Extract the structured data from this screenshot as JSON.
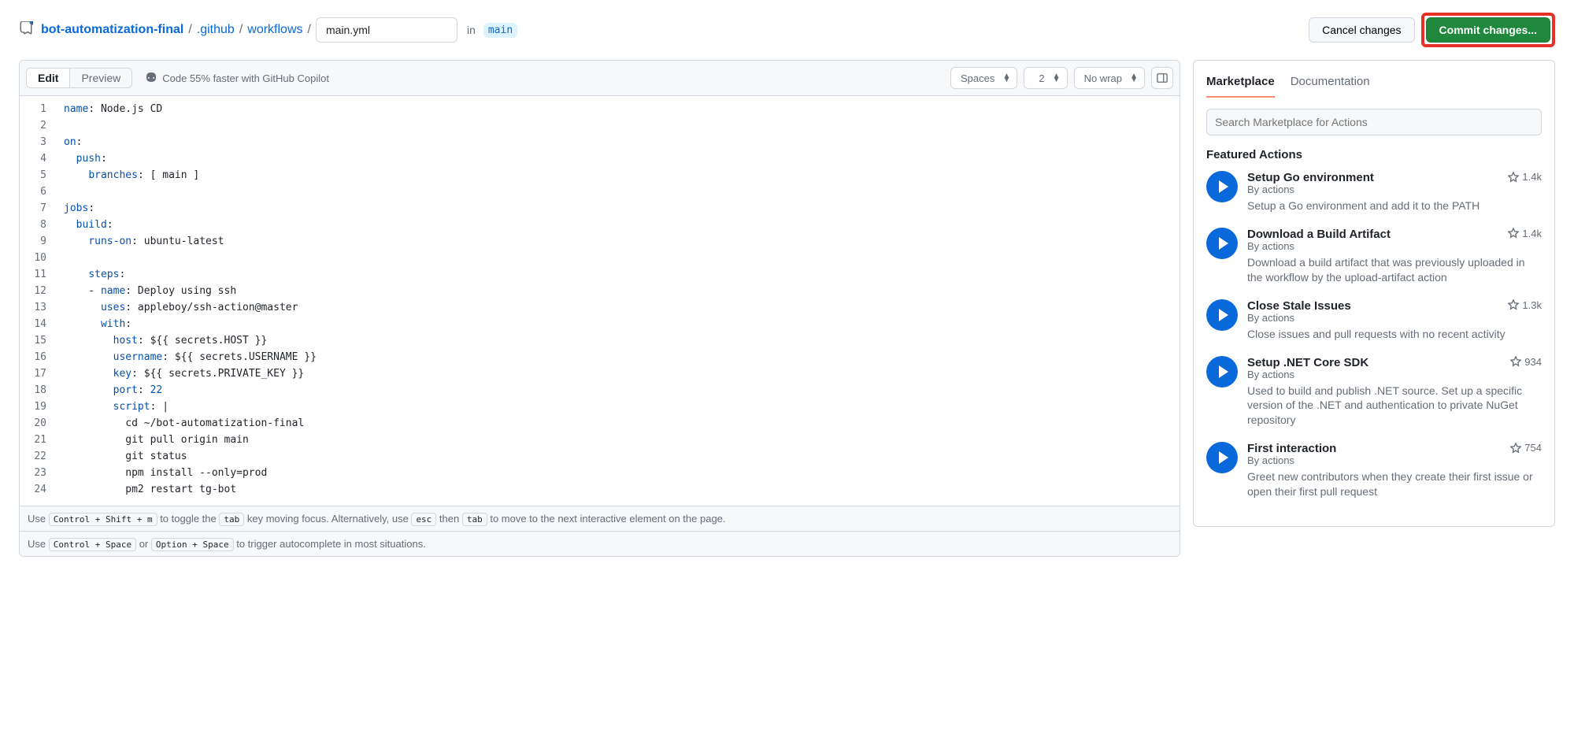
{
  "breadcrumb": {
    "repo": "bot-automatization-final",
    "seg1": ".github",
    "seg2": "workflows",
    "filename": "main.yml",
    "in_label": "in",
    "branch": "main"
  },
  "top_actions": {
    "cancel": "Cancel changes",
    "commit": "Commit changes..."
  },
  "editor": {
    "tab_edit": "Edit",
    "tab_preview": "Preview",
    "copilot_hint": "Code 55% faster with GitHub Copilot",
    "indent": "Spaces",
    "indent_size": "2",
    "wrap": "No wrap"
  },
  "code": {
    "lines": [
      [
        [
          "key",
          "name"
        ],
        [
          "str",
          ": Node.js CD"
        ]
      ],
      [],
      [
        [
          "key",
          "on"
        ],
        [
          "str",
          ":"
        ]
      ],
      [
        [
          "str",
          "  "
        ],
        [
          "key",
          "push"
        ],
        [
          "str",
          ":"
        ]
      ],
      [
        [
          "str",
          "    "
        ],
        [
          "key",
          "branches"
        ],
        [
          "str",
          ": [ main ]"
        ]
      ],
      [],
      [
        [
          "key",
          "jobs"
        ],
        [
          "str",
          ":"
        ]
      ],
      [
        [
          "str",
          "  "
        ],
        [
          "key",
          "build"
        ],
        [
          "str",
          ":"
        ]
      ],
      [
        [
          "str",
          "    "
        ],
        [
          "key",
          "runs-on"
        ],
        [
          "str",
          ": ubuntu-latest"
        ]
      ],
      [],
      [
        [
          "str",
          "    "
        ],
        [
          "key",
          "steps"
        ],
        [
          "str",
          ":"
        ]
      ],
      [
        [
          "str",
          "    - "
        ],
        [
          "key",
          "name"
        ],
        [
          "str",
          ": Deploy using ssh"
        ]
      ],
      [
        [
          "str",
          "      "
        ],
        [
          "key",
          "uses"
        ],
        [
          "str",
          ": appleboy/ssh-action@master"
        ]
      ],
      [
        [
          "str",
          "      "
        ],
        [
          "key",
          "with"
        ],
        [
          "str",
          ":"
        ]
      ],
      [
        [
          "str",
          "        "
        ],
        [
          "key",
          "host"
        ],
        [
          "str",
          ": ${{ secrets.HOST }}"
        ]
      ],
      [
        [
          "str",
          "        "
        ],
        [
          "key",
          "username"
        ],
        [
          "str",
          ": ${{ secrets.USERNAME }}"
        ]
      ],
      [
        [
          "str",
          "        "
        ],
        [
          "key",
          "key"
        ],
        [
          "str",
          ": ${{ secrets.PRIVATE_KEY }}"
        ]
      ],
      [
        [
          "str",
          "        "
        ],
        [
          "key",
          "port"
        ],
        [
          "str",
          ": "
        ],
        [
          "num",
          "22"
        ]
      ],
      [
        [
          "str",
          "        "
        ],
        [
          "key",
          "script"
        ],
        [
          "str",
          ": |"
        ]
      ],
      [
        [
          "str",
          "          cd ~/bot-automatization-final"
        ]
      ],
      [
        [
          "str",
          "          git pull origin main"
        ]
      ],
      [
        [
          "str",
          "          git status"
        ]
      ],
      [
        [
          "str",
          "          npm install --only=prod"
        ]
      ],
      [
        [
          "str",
          "          pm2 restart tg-bot"
        ]
      ]
    ]
  },
  "hints": {
    "h1a": "Use ",
    "h1k1": "Control + Shift + m",
    "h1b": " to toggle the ",
    "h1k2": "tab",
    "h1c": " key moving focus. Alternatively, use ",
    "h1k3": "esc",
    "h1d": " then ",
    "h1k4": "tab",
    "h1e": " to move to the next interactive element on the page.",
    "h2a": "Use ",
    "h2k1": "Control + Space",
    "h2b": " or ",
    "h2k2": "Option + Space",
    "h2c": " to trigger autocomplete in most situations."
  },
  "sidebar": {
    "tab_market": "Marketplace",
    "tab_docs": "Documentation",
    "search_placeholder": "Search Marketplace for Actions",
    "featured": "Featured Actions",
    "by_prefix": "By ",
    "actions": [
      {
        "title": "Setup Go environment",
        "author": "actions",
        "stars": "1.4k",
        "desc": "Setup a Go environment and add it to the PATH"
      },
      {
        "title": "Download a Build Artifact",
        "author": "actions",
        "stars": "1.4k",
        "desc": "Download a build artifact that was previously uploaded in the workflow by the upload-artifact action"
      },
      {
        "title": "Close Stale Issues",
        "author": "actions",
        "stars": "1.3k",
        "desc": "Close issues and pull requests with no recent activity"
      },
      {
        "title": "Setup .NET Core SDK",
        "author": "actions",
        "stars": "934",
        "desc": "Used to build and publish .NET source. Set up a specific version of the .NET and authentication to private NuGet repository"
      },
      {
        "title": "First interaction",
        "author": "actions",
        "stars": "754",
        "desc": "Greet new contributors when they create their first issue or open their first pull request"
      }
    ]
  }
}
